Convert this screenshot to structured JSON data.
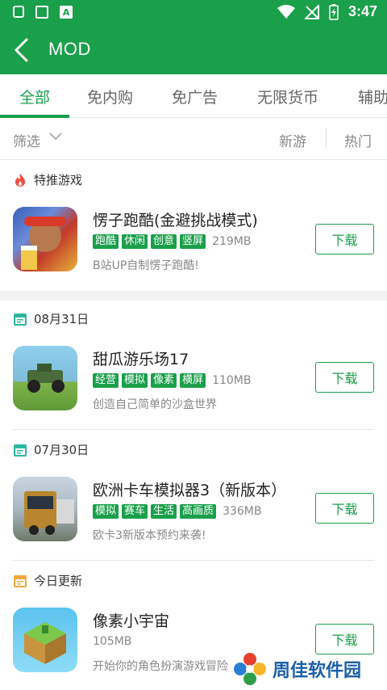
{
  "status": {
    "time": "3:47"
  },
  "header": {
    "title": "MOD"
  },
  "tabs": [
    {
      "label": "全部"
    },
    {
      "label": "免内购"
    },
    {
      "label": "免广告"
    },
    {
      "label": "无限货币"
    },
    {
      "label": "辅助"
    }
  ],
  "filter": {
    "label": "筛选",
    "sort_new": "新游",
    "sort_hot": "热门"
  },
  "sections": [
    {
      "title": "特推游戏",
      "apps": [
        {
          "name": "愣子跑酷(金避挑战模式)",
          "tags": [
            "跑酷",
            "休闲",
            "创意",
            "竖屏"
          ],
          "size": "219MB",
          "desc": "B站UP自制愣子跑酷!",
          "button": "下载"
        }
      ]
    },
    {
      "title": "08月31日",
      "apps": [
        {
          "name": "甜瓜游乐场17",
          "tags": [
            "经营",
            "模拟",
            "像素",
            "横屏"
          ],
          "size": "110MB",
          "desc": "创造自己简单的沙盒世界",
          "button": "下载"
        }
      ]
    },
    {
      "title": "07月30日",
      "apps": [
        {
          "name": "欧洲卡车模拟器3（新版本）",
          "tags": [
            "模拟",
            "赛车",
            "生活",
            "高画质"
          ],
          "size": "336MB",
          "desc": "欧卡3新版本预约来袭!",
          "button": "下载"
        }
      ]
    },
    {
      "title": "今日更新",
      "apps": [
        {
          "name": "像素小宇宙",
          "tags": [],
          "size": "105MB",
          "desc": "开始你的角色扮演游戏冒险",
          "button": "下载"
        }
      ]
    }
  ],
  "watermark": {
    "text": "周佳软件园"
  },
  "colors": {
    "primary": "#1a9f4a",
    "watermark": "#1b5fa8"
  }
}
